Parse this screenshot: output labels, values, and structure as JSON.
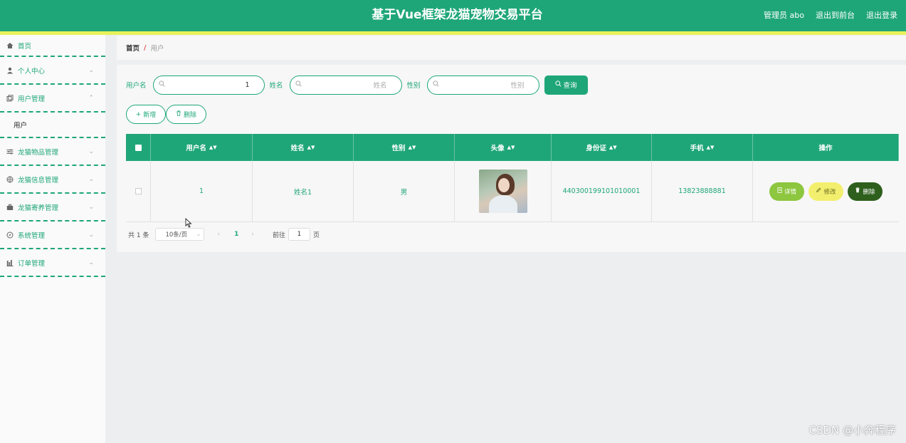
{
  "header": {
    "title": "基于Vue框架龙猫宠物交易平台",
    "admin_label": "管理员 abo",
    "exit_front": "退出到前台",
    "logout": "退出登录"
  },
  "sidebar": {
    "items": [
      {
        "label": "首页",
        "icon": "home-icon"
      },
      {
        "label": "个人中心",
        "icon": "user-icon"
      },
      {
        "label": "用户管理",
        "icon": "copy-icon"
      },
      {
        "label": "用户",
        "icon": ""
      },
      {
        "label": "龙猫物品管理",
        "icon": "sliders-icon"
      },
      {
        "label": "龙猫信息管理",
        "icon": "globe-icon"
      },
      {
        "label": "龙猫寄养管理",
        "icon": "briefcase-icon"
      },
      {
        "label": "系统管理",
        "icon": "compass-icon"
      },
      {
        "label": "订单管理",
        "icon": "chart-icon"
      }
    ]
  },
  "breadcrumb": {
    "home": "首页",
    "separator": "/",
    "current": "用户"
  },
  "search": {
    "username_label": "用户名",
    "username_value": "1",
    "name_label": "姓名",
    "name_placeholder": "姓名",
    "gender_label": "性别",
    "gender_placeholder": "性别",
    "query_button": "查询"
  },
  "actions": {
    "add": "新增",
    "delete": "删除"
  },
  "table": {
    "headers": [
      "用户名",
      "姓名",
      "性别",
      "头像",
      "身份证",
      "手机",
      "操作"
    ],
    "rows": [
      {
        "username": "1",
        "name": "姓名1",
        "gender": "男",
        "id_card": "440300199101010001",
        "phone": "13823888881",
        "ops": {
          "detail": "详情",
          "edit": "修改",
          "delete": "删除"
        }
      }
    ]
  },
  "pagination": {
    "total": "共 1 条",
    "page_size": "10条/页",
    "current_page": "1",
    "goto_label": "前往",
    "goto_value": "1",
    "page_unit": "页"
  },
  "watermark": "CSDN @小奔程序",
  "colors": {
    "primary": "#1fa678",
    "accent_strip": "#e8f25a",
    "detail": "#8dc63f",
    "edit": "#f3ef6e",
    "delete": "#2e5f1d"
  }
}
